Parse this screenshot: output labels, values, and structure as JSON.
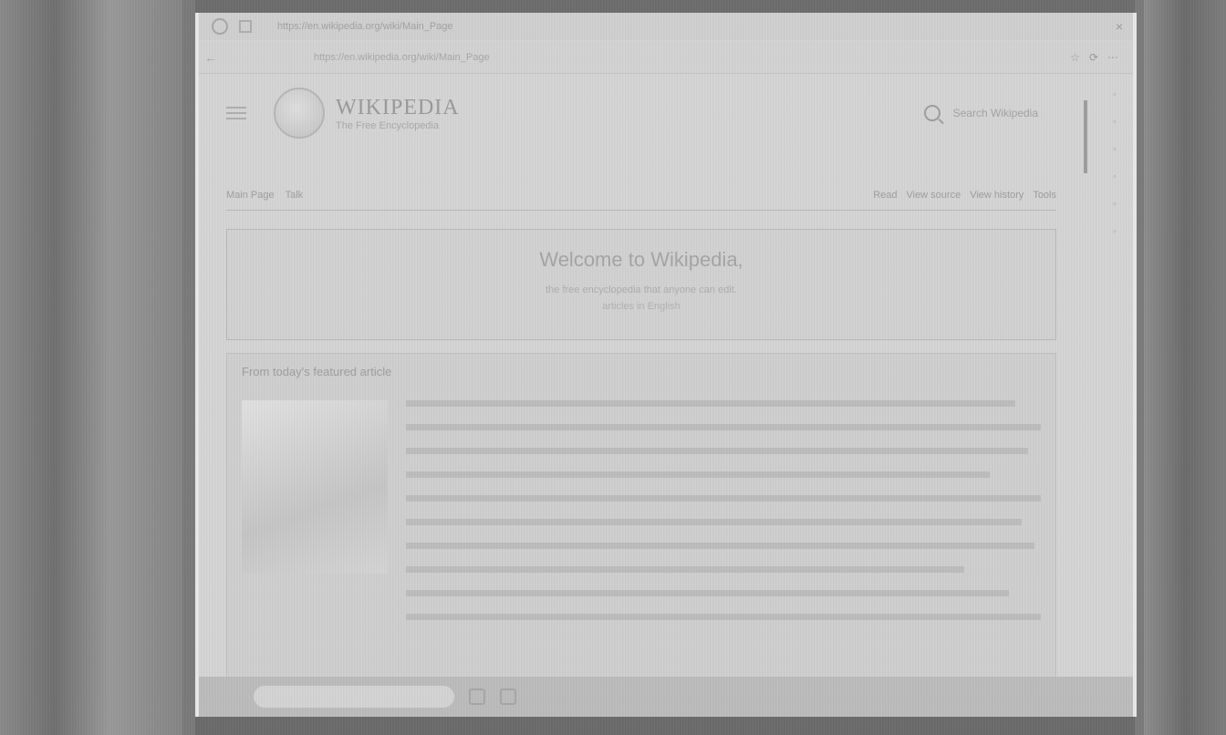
{
  "window": {
    "title": "https://en.wikipedia.org/wiki/Main_Page",
    "close_glyph": "×"
  },
  "toolbar": {
    "back_glyph": "←",
    "url": "https://en.wikipedia.org/wiki/Main_Page",
    "icons": [
      "☆",
      "⟳",
      "⋯"
    ]
  },
  "wikipedia": {
    "name": "WIKIPEDIA",
    "tagline": "The Free Encyclopedia",
    "search_placeholder": "Search Wikipedia"
  },
  "tabs": {
    "left": [
      "Main Page",
      "Talk"
    ],
    "right": [
      "Read",
      "View source",
      "View history",
      "Tools"
    ]
  },
  "welcome": {
    "title": "Welcome to Wikipedia,",
    "subtitle": "the free encyclopedia that anyone can edit.",
    "count": "articles in English"
  },
  "featured": {
    "heading": "From today's featured article"
  }
}
